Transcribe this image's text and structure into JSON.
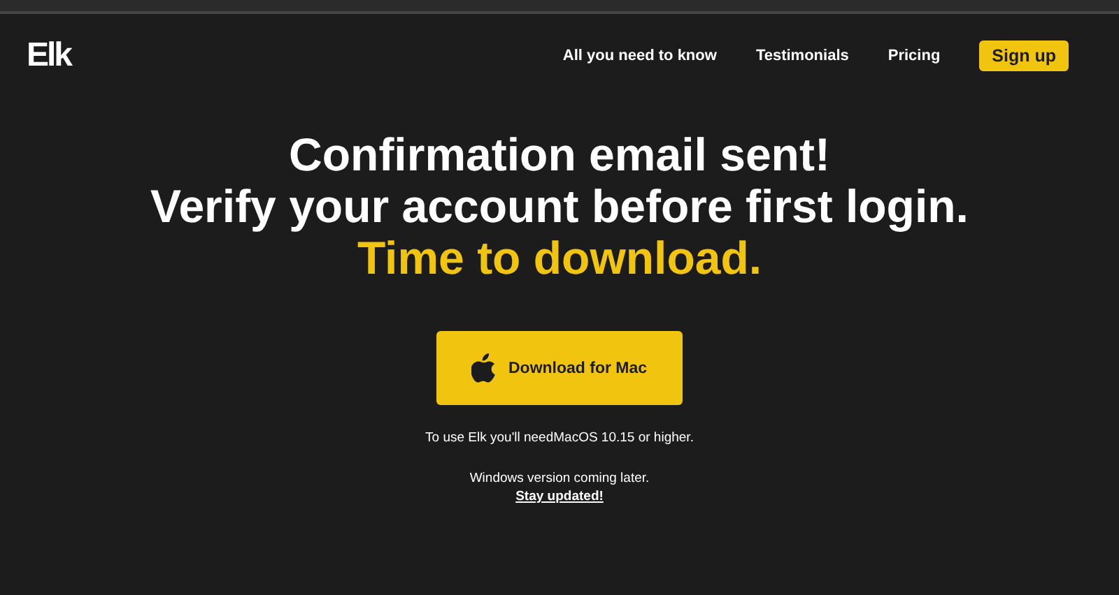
{
  "logo": "Elk",
  "nav": [
    {
      "label": "All you need to know",
      "kind": "link"
    },
    {
      "label": "Testimonials",
      "kind": "link"
    },
    {
      "label": "Pricing",
      "kind": "link"
    },
    {
      "label": "Sign up",
      "kind": "button"
    }
  ],
  "headline": [
    "Confirmation email sent!",
    "Verify your account before first login."
  ],
  "highlight": "Time to download.",
  "download_button": "Download for Mac",
  "requirement": "To use Elk you'll needMacOS 10.15 or higher.",
  "windows_note": "Windows version coming later.",
  "stay_updated": "Stay updated!"
}
